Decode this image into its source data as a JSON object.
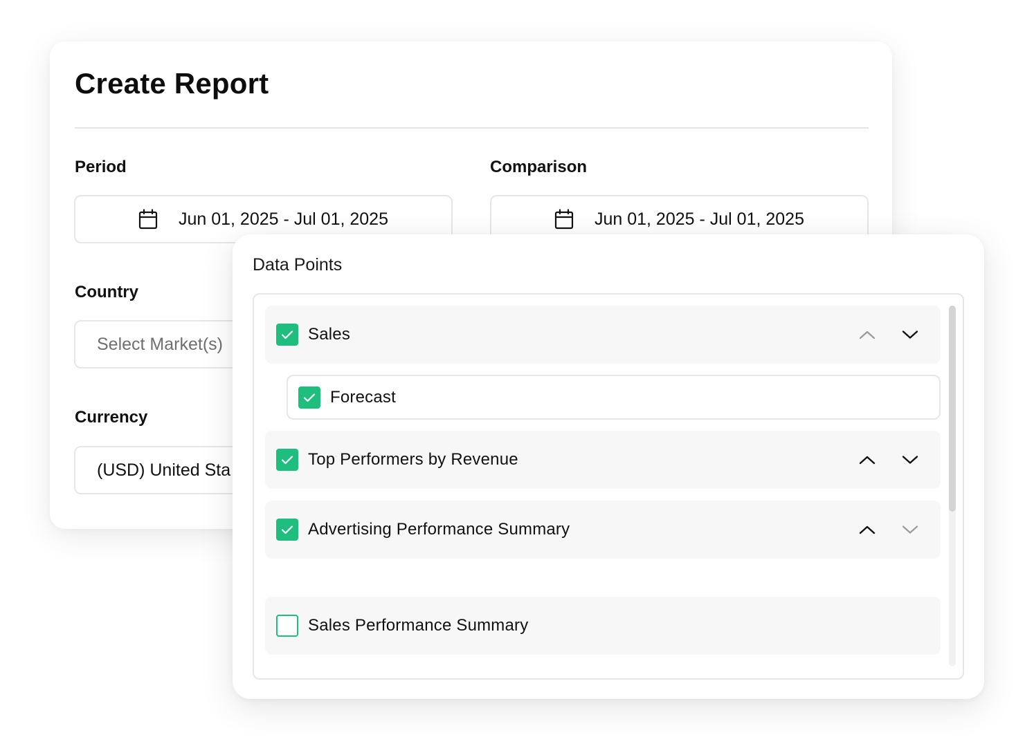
{
  "report": {
    "title": "Create Report",
    "period": {
      "label": "Period",
      "value": "Jun 01, 2025 - Jul 01, 2025",
      "icon": "calendar-icon"
    },
    "comparison": {
      "label": "Comparison",
      "value": "Jun 01, 2025 - Jul 01, 2025",
      "icon": "calendar-icon"
    },
    "country": {
      "label": "Country",
      "placeholder": "Select Market(s)"
    },
    "currency": {
      "label": "Currency",
      "value": "(USD) United Sta"
    }
  },
  "data_points": {
    "title": "Data Points",
    "accent_color": "#1fbd7e",
    "items": [
      {
        "label": "Sales",
        "checked": true,
        "up_arrow_enabled": false,
        "down_arrow_enabled": true
      },
      {
        "label": "Forecast",
        "checked": true
      },
      {
        "label": "Top Performers by Revenue",
        "checked": true,
        "up_arrow_enabled": true,
        "down_arrow_enabled": true
      },
      {
        "label": "Advertising Performance Summary",
        "checked": true,
        "up_arrow_enabled": true,
        "down_arrow_enabled": false
      },
      {
        "label": "Sales Performance Summary",
        "checked": false
      }
    ]
  }
}
